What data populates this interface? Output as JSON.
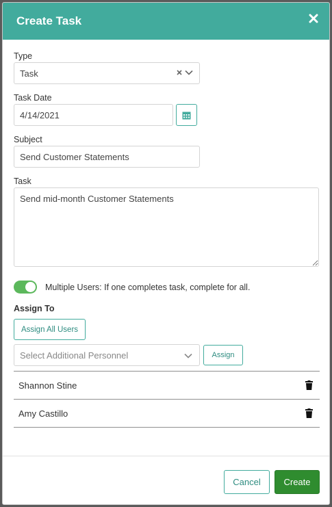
{
  "modal": {
    "title": "Create Task",
    "close_icon": "close-icon"
  },
  "type": {
    "label": "Type",
    "value": "Task",
    "clear_icon": "clear-icon",
    "chevron_icon": "chevron-down-icon"
  },
  "task_date": {
    "label": "Task Date",
    "value": "4/14/2021",
    "calendar_icon": "calendar-icon"
  },
  "subject": {
    "label": "Subject",
    "value": "Send Customer Statements"
  },
  "task": {
    "label": "Task",
    "value": "Send mid-month Customer Statements"
  },
  "multiple_users": {
    "enabled": true,
    "label": "Multiple Users: If one completes task, complete for all."
  },
  "assign_to": {
    "title": "Assign To",
    "assign_all_label": "Assign All Users",
    "personnel_placeholder": "Select Additional Personnel",
    "assign_label": "Assign",
    "users": [
      {
        "name": "Shannon Stine"
      },
      {
        "name": "Amy Castillo"
      }
    ]
  },
  "footer": {
    "cancel_label": "Cancel",
    "create_label": "Create"
  },
  "colors": {
    "header": "#42ab9d",
    "toggle_on": "#5cb85c",
    "create_button": "#2f8c2f"
  }
}
